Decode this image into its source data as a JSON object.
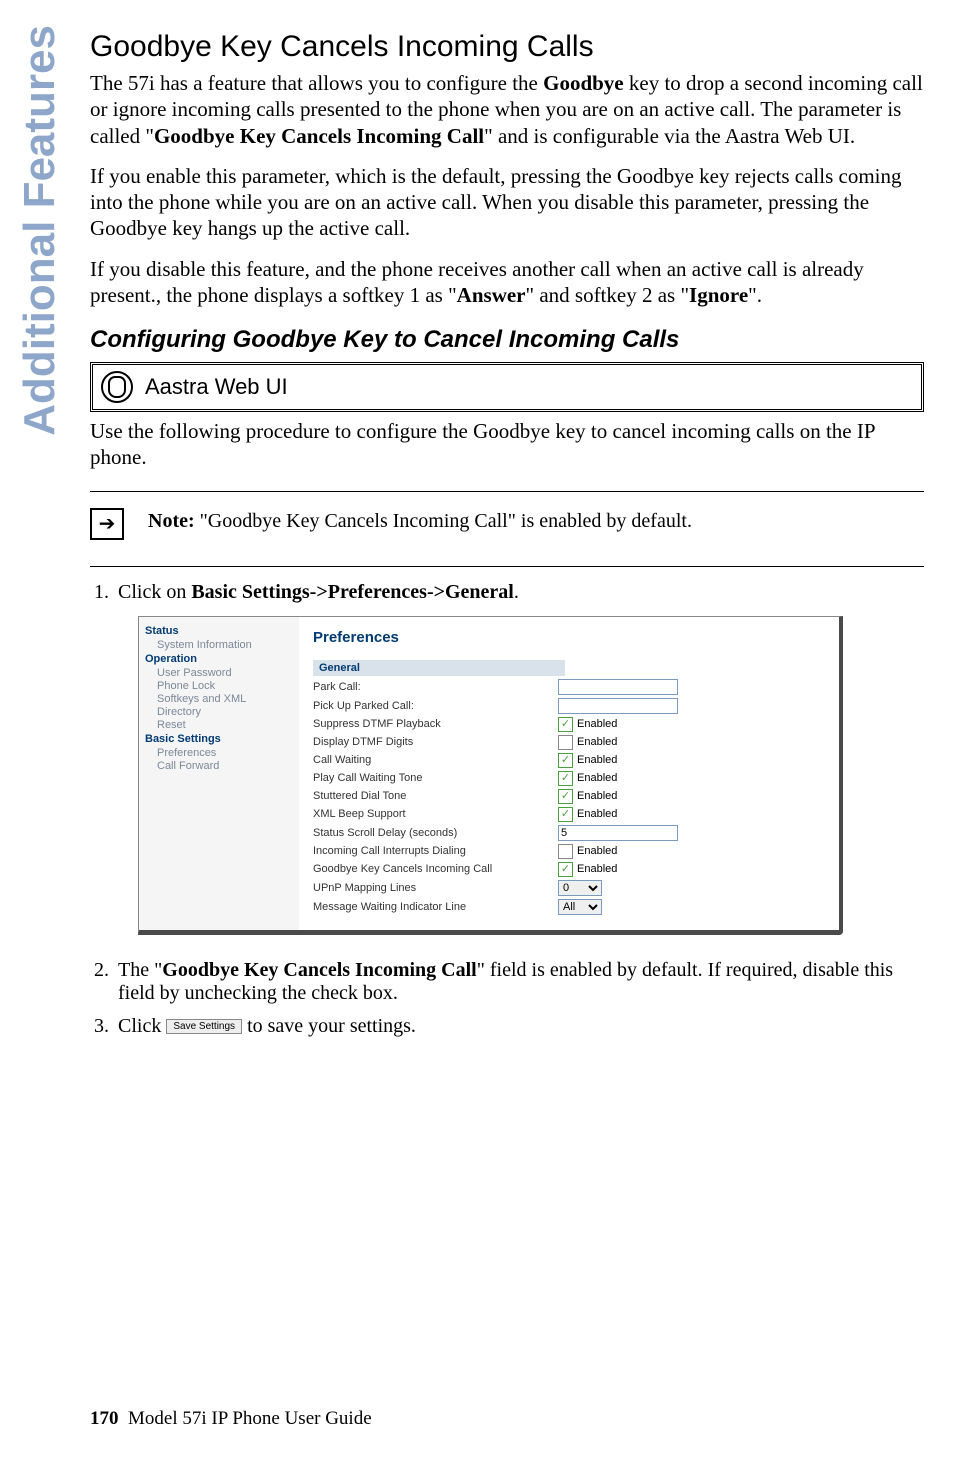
{
  "side_tab": "Additional Features",
  "title": "Goodbye Key Cancels Incoming Calls",
  "para1_pre": "The 57i has a feature that allows you to configure the ",
  "para1_b1": "Goodbye",
  "para1_mid1": " key to drop a second incoming call or ignore incoming calls presented to the phone when you are on an active call. The parameter is called \"",
  "para1_b2": "Goodbye Key Cancels Incoming Call",
  "para1_post": "\" and is configurable via the Aastra Web UI.",
  "para2": "If you enable this parameter, which is the default, pressing the Goodbye key rejects calls coming into the phone while you are on an active call. When you disable this parameter, pressing the Goodbye key hangs up the active call.",
  "para3_pre": "If you disable this feature, and the phone receives another call when an active call is already present., the phone displays a softkey 1 as \"",
  "para3_b1": "Answer",
  "para3_mid": "\" and softkey 2 as \"",
  "para3_b2": "Ignore",
  "para3_post": "\".",
  "subtitle": "Configuring Goodbye Key to Cancel Incoming Calls",
  "webui_label": "Aastra Web UI",
  "intro2": "Use the following procedure to configure the Goodbye key to cancel incoming calls on the IP phone.",
  "note_label": "Note:",
  "note_text": " \"Goodbye Key Cancels Incoming Call\" is enabled by default.",
  "steps": {
    "s1_pre": "Click on ",
    "s1_b": "Basic Settings->Preferences->General",
    "s1_post": ".",
    "s2_pre": "The \"",
    "s2_b": "Goodbye Key Cancels Incoming Call",
    "s2_post": "\" field is enabled by default. If required, disable this field by unchecking the check box.",
    "s3_pre": "Click ",
    "s3_btn": "Save Settings",
    "s3_post": " to save your settings."
  },
  "figure": {
    "side": {
      "status": "Status",
      "sysinfo": "System Information",
      "operation": "Operation",
      "items_op": [
        "User Password",
        "Phone Lock",
        "Softkeys and XML",
        "Directory",
        "Reset"
      ],
      "basic": "Basic Settings",
      "items_bs": [
        "Preferences",
        "Call Forward"
      ]
    },
    "main": {
      "pref_title": "Preferences",
      "general": "General",
      "rows": [
        {
          "label": "Park Call:",
          "type": "text",
          "value": ""
        },
        {
          "label": "Pick Up Parked Call:",
          "type": "text",
          "value": ""
        },
        {
          "label": "Suppress DTMF Playback",
          "type": "check",
          "checked": true,
          "after": "Enabled"
        },
        {
          "label": "Display DTMF Digits",
          "type": "check",
          "checked": false,
          "after": "Enabled"
        },
        {
          "label": "Call Waiting",
          "type": "check",
          "checked": true,
          "after": "Enabled"
        },
        {
          "label": "Play Call Waiting Tone",
          "type": "check",
          "checked": true,
          "after": "Enabled"
        },
        {
          "label": "Stuttered Dial Tone",
          "type": "check",
          "checked": true,
          "after": "Enabled"
        },
        {
          "label": "XML Beep Support",
          "type": "check",
          "checked": true,
          "after": "Enabled"
        },
        {
          "label": "Status Scroll Delay (seconds)",
          "type": "text",
          "value": "5",
          "wide": true
        },
        {
          "label": "Incoming Call Interrupts Dialing",
          "type": "check",
          "checked": false,
          "after": "Enabled"
        },
        {
          "label": "Goodbye Key Cancels Incoming Call",
          "type": "check",
          "checked": true,
          "after": "Enabled"
        },
        {
          "label": "UPnP Mapping Lines",
          "type": "select",
          "value": "0"
        },
        {
          "label": "Message Waiting Indicator Line",
          "type": "select",
          "value": "All"
        }
      ]
    }
  },
  "footer": {
    "page": "170",
    "title": "Model 57i IP Phone User Guide"
  }
}
